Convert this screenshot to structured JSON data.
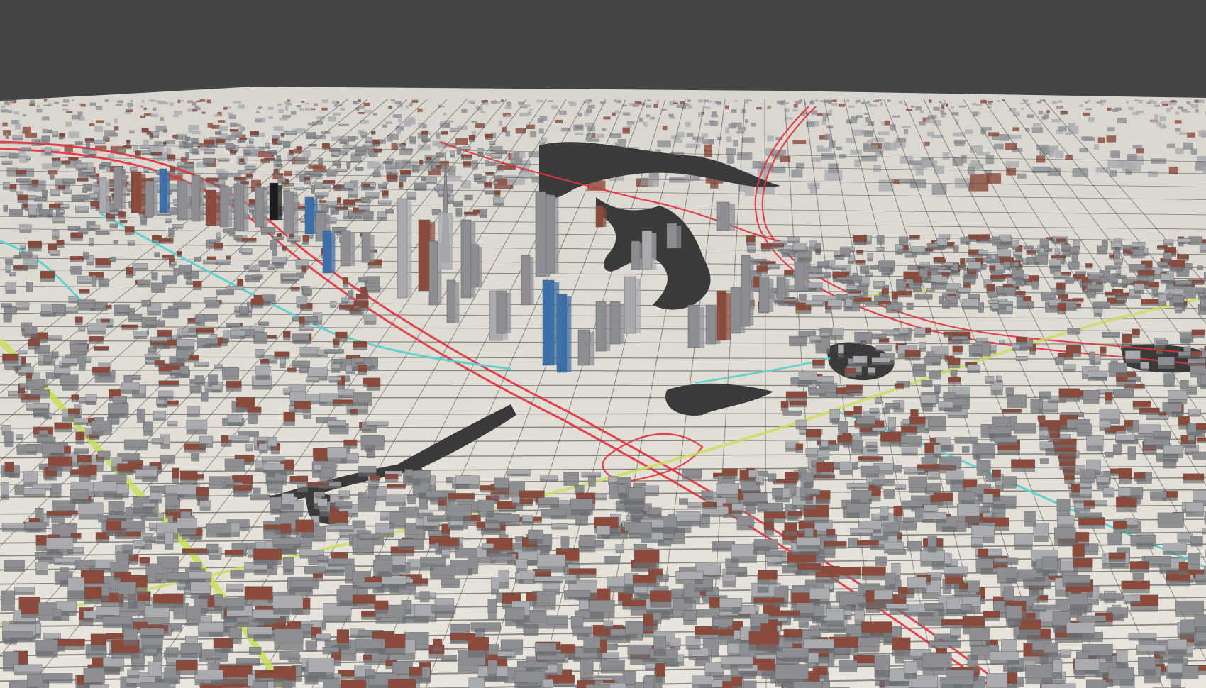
{
  "viewport": {
    "type": "3d-city-model-view",
    "labels": []
  },
  "palette": {
    "sky": "#444546",
    "ground": "#e9e5dc",
    "ground_far": "#d9d6cf",
    "water": "#3a3a3a",
    "building_gray": "#8c8e92",
    "building_light": "#a9abaf",
    "building_brick": "#8a4a3c",
    "building_blue": "#3f6fa8",
    "building_dark": "#1c1c1e",
    "highway": "#e0323c",
    "arterial_yellow": "#c8df5a",
    "arterial_cyan": "#5fd2cf",
    "street": "#3d3e40"
  },
  "layers": [
    {
      "name": "terrain",
      "icon": "terrain-icon"
    },
    {
      "name": "buildings",
      "icon": "building-icon"
    },
    {
      "name": "highways",
      "icon": "road-icon"
    },
    {
      "name": "waterways",
      "icon": "water-icon"
    }
  ]
}
